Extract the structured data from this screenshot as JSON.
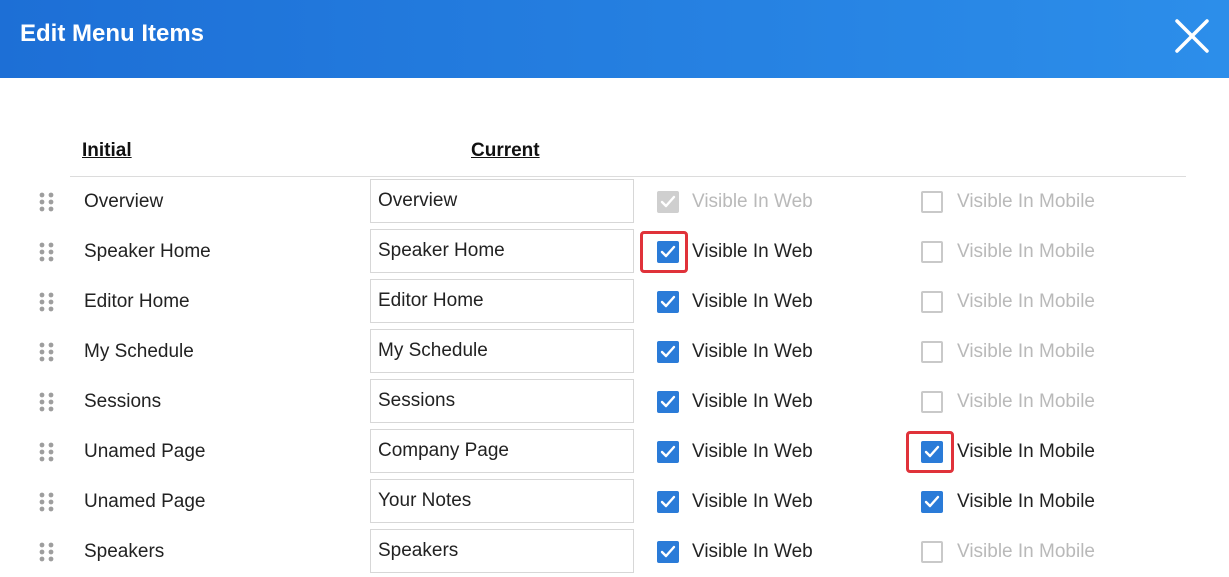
{
  "dialog": {
    "title": "Edit Menu Items",
    "close_icon": "close-icon"
  },
  "columns": {
    "initial": "Initial",
    "current": "Current"
  },
  "colors": {
    "header_start": "#1d6fd6",
    "header_end": "#2c8eea",
    "checkbox_checked": "#2a7bd8",
    "highlight": "#e0323a",
    "disabled_text": "#b9b9b9"
  },
  "rows": [
    {
      "initial": "Overview",
      "current": "Overview",
      "web_label": "Visible In Web",
      "mobile_label": "Visible In Mobile",
      "web_checked": true,
      "web_disabled": true,
      "mobile_checked": false,
      "web_highlight": false,
      "mobile_highlight": false
    },
    {
      "initial": "Speaker Home",
      "current": "Speaker Home",
      "web_label": "Visible In Web",
      "mobile_label": "Visible In Mobile",
      "web_checked": true,
      "web_disabled": false,
      "mobile_checked": false,
      "web_highlight": true,
      "mobile_highlight": false
    },
    {
      "initial": "Editor Home",
      "current": "Editor Home",
      "web_label": "Visible In Web",
      "mobile_label": "Visible In Mobile",
      "web_checked": true,
      "web_disabled": false,
      "mobile_checked": false,
      "web_highlight": false,
      "mobile_highlight": false
    },
    {
      "initial": "My Schedule",
      "current": "My Schedule",
      "web_label": "Visible In Web",
      "mobile_label": "Visible In Mobile",
      "web_checked": true,
      "web_disabled": false,
      "mobile_checked": false,
      "web_highlight": false,
      "mobile_highlight": false
    },
    {
      "initial": "Sessions",
      "current": "Sessions",
      "web_label": "Visible In Web",
      "mobile_label": "Visible In Mobile",
      "web_checked": true,
      "web_disabled": false,
      "mobile_checked": false,
      "web_highlight": false,
      "mobile_highlight": false
    },
    {
      "initial": "Unamed Page",
      "current": "Company Page",
      "web_label": "Visible In Web",
      "mobile_label": "Visible In Mobile",
      "web_checked": true,
      "web_disabled": false,
      "mobile_checked": true,
      "web_highlight": false,
      "mobile_highlight": true
    },
    {
      "initial": "Unamed Page",
      "current": "Your Notes",
      "web_label": "Visible In Web",
      "mobile_label": "Visible In Mobile",
      "web_checked": true,
      "web_disabled": false,
      "mobile_checked": true,
      "web_highlight": false,
      "mobile_highlight": false
    },
    {
      "initial": "Speakers",
      "current": "Speakers",
      "web_label": "Visible In Web",
      "mobile_label": "Visible In Mobile",
      "web_checked": true,
      "web_disabled": false,
      "mobile_checked": false,
      "web_highlight": false,
      "mobile_highlight": false
    }
  ]
}
